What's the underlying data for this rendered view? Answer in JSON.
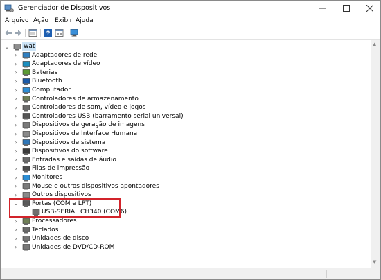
{
  "window": {
    "title": "Gerenciador de Dispositivos"
  },
  "menu": [
    "Arquivo",
    "Ação",
    "Exibir",
    "Ajuda"
  ],
  "toolbar": {
    "buttons": [
      "back-icon",
      "forward-icon",
      "properties-icon",
      "help-icon",
      "view-icon",
      "scan-hardware-icon"
    ]
  },
  "tree": {
    "root": "wat",
    "categories": [
      {
        "label": "Adaptadores de rede",
        "icon": "network-adapter-icon",
        "color": "#2f7fc1",
        "expanded": false
      },
      {
        "label": "Adaptadores de vídeo",
        "icon": "display-adapter-icon",
        "color": "#1c8fbf",
        "expanded": false
      },
      {
        "label": "Baterias",
        "icon": "battery-icon",
        "color": "#5b9a34",
        "expanded": false
      },
      {
        "label": "Bluetooth",
        "icon": "bluetooth-icon",
        "color": "#1a5aa8",
        "expanded": false
      },
      {
        "label": "Computador",
        "icon": "computer-icon",
        "color": "#2d8fd6",
        "expanded": false
      },
      {
        "label": "Controladores de armazenamento",
        "icon": "storage-controller-icon",
        "color": "#6f7f56",
        "expanded": false
      },
      {
        "label": "Controladores de som, vídeo e jogos",
        "icon": "sound-icon",
        "color": "#6b6b6b",
        "expanded": false
      },
      {
        "label": "Controladores USB (barramento serial universal)",
        "icon": "usb-icon",
        "color": "#555555",
        "expanded": false
      },
      {
        "label": "Dispositivos de geração de imagens",
        "icon": "camera-icon",
        "color": "#7a7a7a",
        "expanded": false
      },
      {
        "label": "Dispositivos de Interface Humana",
        "icon": "hid-icon",
        "color": "#8a8a8a",
        "expanded": false
      },
      {
        "label": "Dispositivos de sistema",
        "icon": "system-device-icon",
        "color": "#2f77b8",
        "expanded": false
      },
      {
        "label": "Dispositivos do software",
        "icon": "software-device-icon",
        "color": "#3b3b3b",
        "expanded": false
      },
      {
        "label": "Entradas e saídas de áudio",
        "icon": "audio-io-icon",
        "color": "#6b6b6b",
        "expanded": false
      },
      {
        "label": "Filas de impressão",
        "icon": "printer-icon",
        "color": "#4d4d4d",
        "expanded": false
      },
      {
        "label": "Monitores",
        "icon": "monitor-icon",
        "color": "#2d8fd6",
        "expanded": false
      },
      {
        "label": "Mouse e outros dispositivos apontadores",
        "icon": "mouse-icon",
        "color": "#7a7a7a",
        "expanded": false
      },
      {
        "label": "Outros dispositivos",
        "icon": "other-device-icon",
        "color": "#8a8a8a",
        "expanded": false
      },
      {
        "label": "Portas (COM e LPT)",
        "icon": "port-icon",
        "color": "#5a5a5a",
        "expanded": true,
        "children": [
          {
            "label": "USB-SERIAL CH340 (COM6)",
            "icon": "port-icon"
          }
        ]
      },
      {
        "label": "Processadores",
        "icon": "processor-icon",
        "color": "#6f7f56",
        "expanded": false
      },
      {
        "label": "Teclados",
        "icon": "keyboard-icon",
        "color": "#6b6b6b",
        "expanded": false
      },
      {
        "label": "Unidades de disco",
        "icon": "disk-drive-icon",
        "color": "#777777",
        "expanded": false
      },
      {
        "label": "Unidades de DVD/CD-ROM",
        "icon": "dvd-drive-icon",
        "color": "#777777",
        "expanded": false
      }
    ]
  },
  "highlight_color": "#d2232a",
  "selection_color": "#cce4f7"
}
